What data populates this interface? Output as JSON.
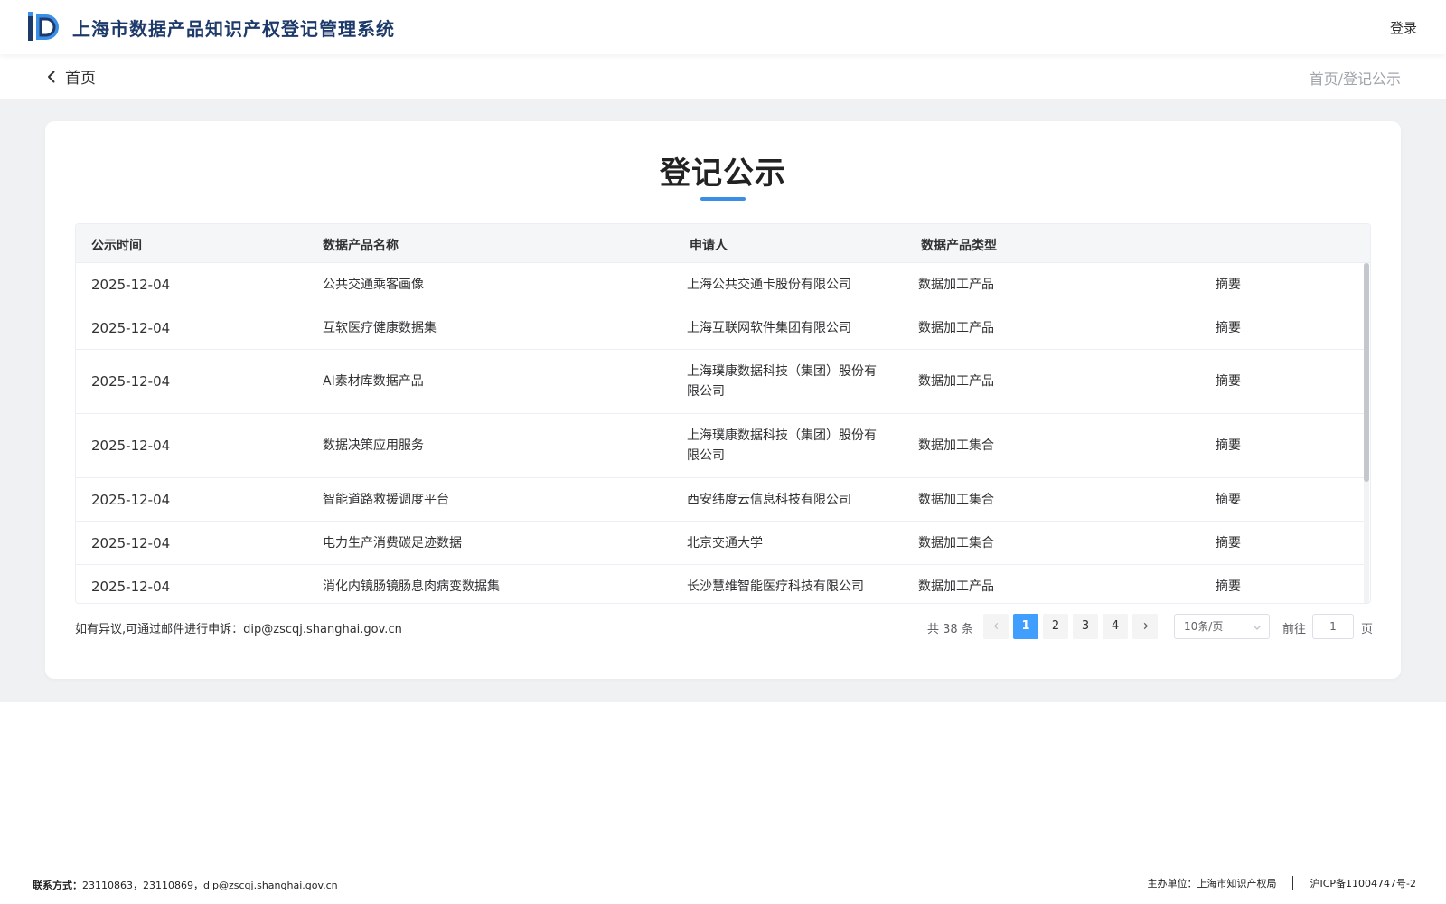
{
  "header": {
    "site_title": "上海市数据产品知识产权登记管理系统",
    "login_label": "登录",
    "brand_color": "#1d3a6b",
    "logo_icon": "dp-logo-icon"
  },
  "subnav": {
    "back_label": "首页",
    "breadcrumb_home": "首页",
    "breadcrumb_sep": "/",
    "breadcrumb_current": "登记公示"
  },
  "page": {
    "title": "登记公示",
    "accent_color": "#3a8ee6"
  },
  "table": {
    "columns": {
      "date": "公示时间",
      "name": "数据产品名称",
      "applicant": "申请人",
      "type": "数据产品类型"
    },
    "rows": [
      {
        "date": "2025-12-04",
        "name": "公共交通乘客画像",
        "applicant": "上海公共交通卡股份有限公司",
        "type": "数据加工产品",
        "action": "摘要"
      },
      {
        "date": "2025-12-04",
        "name": "互软医疗健康数据集",
        "applicant": "上海互联网软件集团有限公司",
        "type": "数据加工产品",
        "action": "摘要"
      },
      {
        "date": "2025-12-04",
        "name": "AI素材库数据产品",
        "applicant": "上海璞康数据科技（集团）股份有限公司",
        "type": "数据加工产品",
        "action": "摘要"
      },
      {
        "date": "2025-12-04",
        "name": "数据决策应用服务",
        "applicant": "上海璞康数据科技（集团）股份有限公司",
        "type": "数据加工集合",
        "action": "摘要"
      },
      {
        "date": "2025-12-04",
        "name": "智能道路救援调度平台",
        "applicant": "西安纬度云信息科技有限公司",
        "type": "数据加工集合",
        "action": "摘要"
      },
      {
        "date": "2025-12-04",
        "name": "电力生产消费碳足迹数据",
        "applicant": "北京交通大学",
        "type": "数据加工集合",
        "action": "摘要"
      },
      {
        "date": "2025-12-04",
        "name": "消化内镜肠镜肠息肉病变数据集",
        "applicant": "长沙慧维智能医疗科技有限公司",
        "type": "数据加工产品",
        "action": "摘要"
      }
    ]
  },
  "appeal": {
    "text": "如有异议,可通过邮件进行申诉：",
    "email": "dip@zscqj.shanghai.gov.cn"
  },
  "pagination": {
    "total_text": "共 38 条",
    "pages": [
      "1",
      "2",
      "3",
      "4"
    ],
    "current_page": "1",
    "prev_icon": "chevron-left-icon",
    "next_icon": "chevron-right-icon",
    "page_size": "10条/页",
    "goto_label": "前往",
    "goto_value": "1",
    "goto_suffix": "页"
  },
  "footer": {
    "contact_label": "联系方式：",
    "contact_value": "23110863，23110869，dip@zscqj.shanghai.gov.cn",
    "host": "主办单位：上海市知识产权局",
    "icp": "沪ICP备11004747号-2"
  }
}
